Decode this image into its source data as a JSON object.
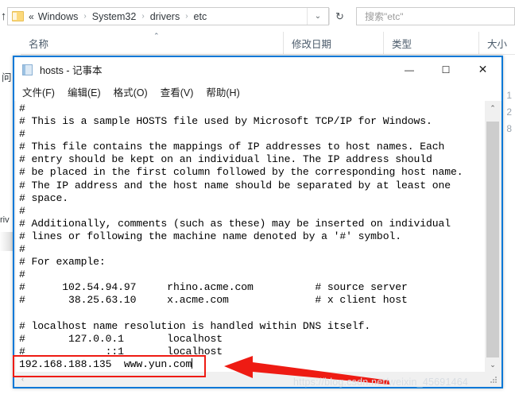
{
  "explorer": {
    "up_button": "↑",
    "breadcrumb": {
      "double_chevron": "«",
      "items": [
        "Windows",
        "System32",
        "drivers",
        "etc"
      ],
      "separator": "›"
    },
    "address_dropdown_icon": "⌄",
    "refresh_icon": "↻",
    "search": {
      "placeholder": "搜索\"etc\""
    },
    "nav_pane": {
      "partial_item_1": "问",
      "partial_item_2": "riv"
    },
    "columns": [
      {
        "label": "名称",
        "sort_indicator": "⌃"
      },
      {
        "label": "修改日期",
        "sort_indicator": ""
      },
      {
        "label": "类型",
        "sort_indicator": ""
      },
      {
        "label": "大小",
        "sort_indicator": ""
      }
    ],
    "size_column_partial_digits": [
      "1",
      "2",
      "8"
    ]
  },
  "notepad": {
    "title": "hosts - 记事本",
    "icon": "notepad-icon",
    "window_buttons": {
      "minimize": "—",
      "maximize": "☐",
      "close": "✕"
    },
    "menu": [
      "文件(F)",
      "编辑(E)",
      "格式(O)",
      "查看(V)",
      "帮助(H)"
    ],
    "document_text": "#\n# This is a sample HOSTS file used by Microsoft TCP/IP for Windows.\n#\n# This file contains the mappings of IP addresses to host names. Each\n# entry should be kept on an individual line. The IP address should\n# be placed in the first column followed by the corresponding host name.\n# The IP address and the host name should be separated by at least one\n# space.\n#\n# Additionally, comments (such as these) may be inserted on individual\n# lines or following the machine name denoted by a '#' symbol.\n#\n# For example:\n#\n#      102.54.94.97     rhino.acme.com          # source server\n#       38.25.63.10     x.acme.com              # x client host\n\n# localhost name resolution is handled within DNS itself.\n#       127.0.0.1       localhost\n#             ::1       localhost\n192.168.188.135  www.yun.com",
    "highlighted_line": "192.168.188.135  www.yun.com",
    "scrollbar": {
      "up_arrow": "⌃",
      "down_arrow": "⌄",
      "left_arrow": "‹"
    }
  },
  "annotations": {
    "highlight_color": "#ee1b13",
    "arrow_color": "#ee1b13",
    "watermark": "https://blog.csdn.net/weixin_45691464"
  }
}
